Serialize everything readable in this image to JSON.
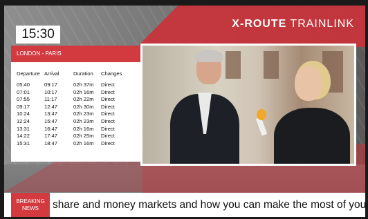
{
  "brand": {
    "strong": "X-ROUTE",
    "light": "TRAINLINK"
  },
  "clock": "15:30",
  "route": "LONDON - PARIS",
  "table": {
    "headers": [
      "Departure",
      "Arrival",
      "Duration",
      "Changes"
    ],
    "rows": [
      [
        "05:40",
        "09:17",
        "02h 37m",
        "Direct"
      ],
      [
        "07:01",
        "10:17",
        "02h 16m",
        "Direct"
      ],
      [
        "07:55",
        "11:17",
        "02h 22m",
        "Direct"
      ],
      [
        "09:17",
        "12:47",
        "02h 30m",
        "Direct"
      ],
      [
        "10:24",
        "13:47",
        "02h 23m",
        "Direct"
      ],
      [
        "12:24",
        "15:47",
        "02h 23m",
        "Direct"
      ],
      [
        "13:31",
        "16:47",
        "02h 16m",
        "Direct"
      ],
      [
        "14:22",
        "17:47",
        "02h 25m",
        "Direct"
      ],
      [
        "15:31",
        "18:47",
        "02h 16m",
        "Direct"
      ]
    ]
  },
  "ticker": {
    "label_line1": "BREAKING",
    "label_line2": "NEWS",
    "text": "share and money markets and how you can make the most of your persona"
  },
  "colors": {
    "accent": "#d33a40",
    "panel": "#ffffff",
    "text": "#111111"
  }
}
